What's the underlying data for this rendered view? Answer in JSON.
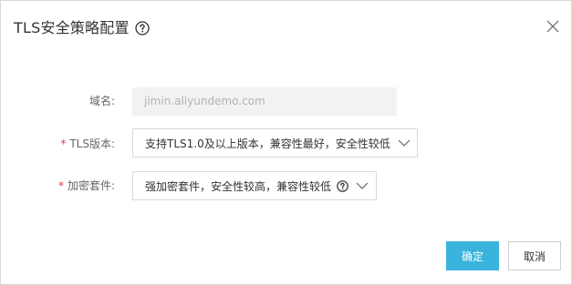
{
  "dialog": {
    "title": "TLS安全策略配置",
    "close_icon": "close-icon",
    "help_icon": "help-circle-icon"
  },
  "form": {
    "domain": {
      "label": "域名:",
      "value": "jimin.aliyundemo.com",
      "required": false
    },
    "tls_version": {
      "required_mark": "*",
      "label": "TLS版本:",
      "value": "支持TLS1.0及以上版本，兼容性最好，安全性较低",
      "icon": "chevron-down-icon"
    },
    "cipher_suite": {
      "required_mark": "*",
      "label": "加密套件:",
      "value": "强加密套件，安全性较高，兼容性较低",
      "help_icon": "help-circle-icon",
      "icon": "chevron-down-icon"
    }
  },
  "footer": {
    "confirm_label": "确定",
    "cancel_label": "取消"
  },
  "colors": {
    "primary": "#3ab4dc",
    "required": "#e43b3b",
    "readonly_bg": "#f2f2f2"
  }
}
